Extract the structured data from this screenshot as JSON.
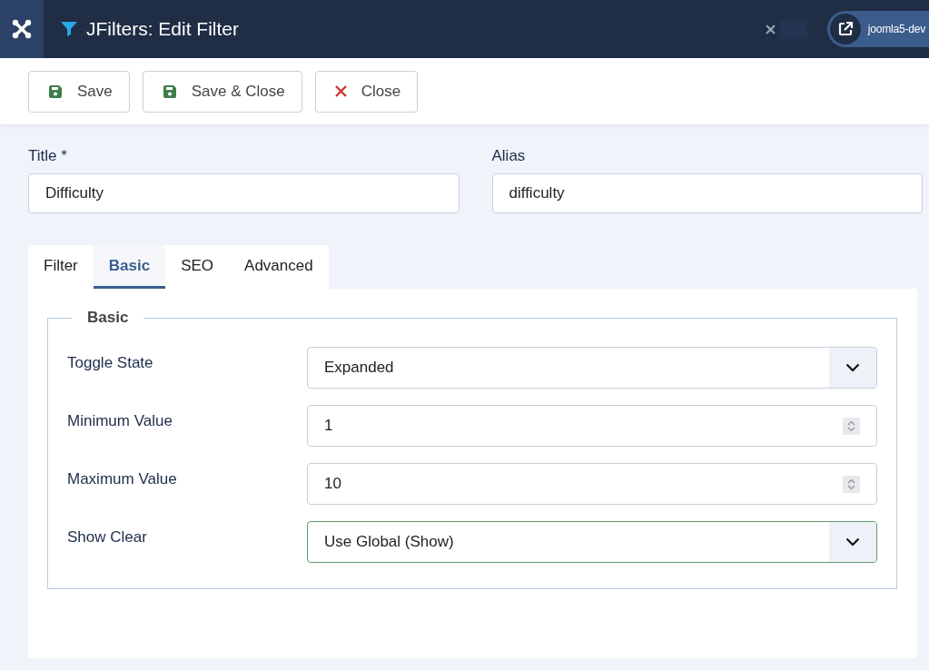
{
  "header": {
    "title": "JFilters: Edit Filter",
    "site_button": "joomla5-dev"
  },
  "toolbar": [
    {
      "label": "Save",
      "kind": "save"
    },
    {
      "label": "Save & Close",
      "kind": "save"
    },
    {
      "label": "Close",
      "kind": "close"
    }
  ],
  "title_field": {
    "label": "Title *",
    "value": "Difficulty"
  },
  "alias_field": {
    "label": "Alias",
    "value": "difficulty"
  },
  "tabs": [
    {
      "label": "Filter",
      "selected": false
    },
    {
      "label": "Basic",
      "selected": true
    },
    {
      "label": "SEO",
      "selected": false
    },
    {
      "label": "Advanced",
      "selected": false
    }
  ],
  "fieldset": {
    "legend": "Basic",
    "fields": [
      {
        "label": "Toggle State",
        "kind": "select",
        "value": "Expanded",
        "valid": false
      },
      {
        "label": "Minimum Value",
        "kind": "number",
        "value": "1",
        "valid": false
      },
      {
        "label": "Maximum Value",
        "kind": "number",
        "value": "10",
        "valid": false
      },
      {
        "label": "Show Clear",
        "kind": "select",
        "value": "Use Global (Show)",
        "valid": true
      }
    ]
  }
}
